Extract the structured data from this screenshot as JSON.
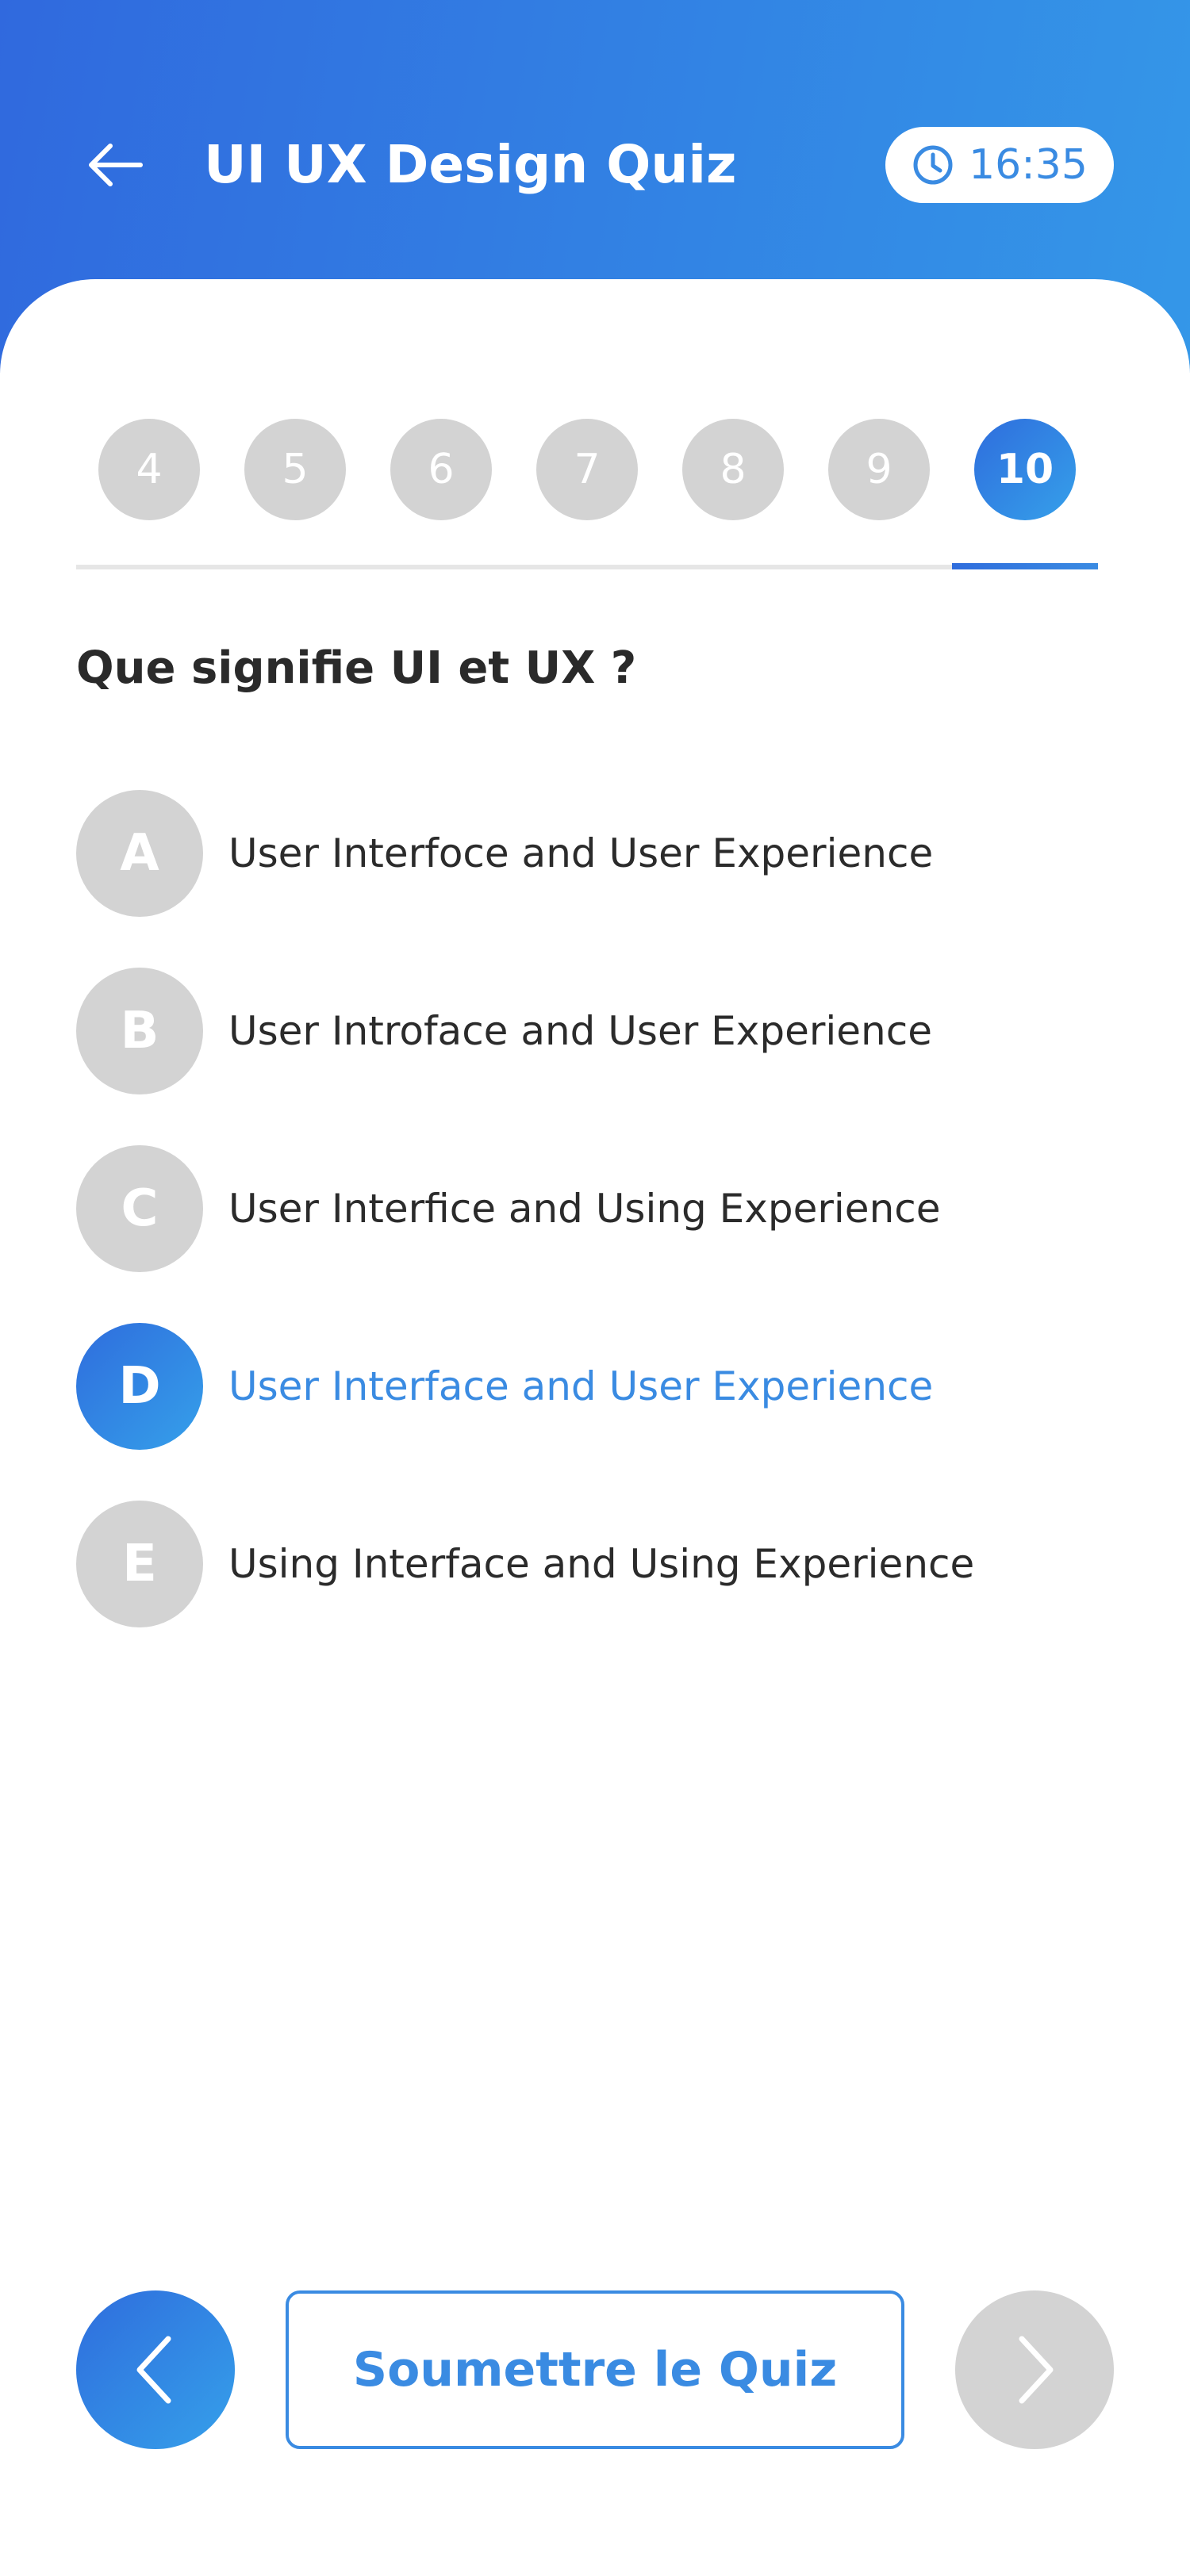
{
  "header": {
    "title": "UI UX Design Quiz",
    "back_icon": "arrow-left-icon",
    "timer": {
      "icon": "clock-icon",
      "value": "16:35"
    }
  },
  "question_nav": {
    "items": [
      "4",
      "5",
      "6",
      "7",
      "8",
      "9",
      "10"
    ],
    "active": "10"
  },
  "question": {
    "text": "Que signifie UI et UX ?"
  },
  "options": [
    {
      "letter": "A",
      "text": "User Interfoce and User Experience",
      "selected": false
    },
    {
      "letter": "B",
      "text": "User Introface and User Experience",
      "selected": false
    },
    {
      "letter": "C",
      "text": "User Interfice and Using Experience",
      "selected": false
    },
    {
      "letter": "D",
      "text": "User Interface and User Experience",
      "selected": true
    },
    {
      "letter": "E",
      "text": "Using Interface and Using Experience",
      "selected": false
    }
  ],
  "footer": {
    "prev_icon": "chevron-left-icon",
    "submit_label": "Soumettre le Quiz",
    "next_icon": "chevron-right-icon"
  },
  "colors": {
    "accent": "#3a8be2",
    "gradient_start": "#2f6ddd",
    "gradient_end": "#35a0ea",
    "inactive": "#d3d3d3"
  }
}
